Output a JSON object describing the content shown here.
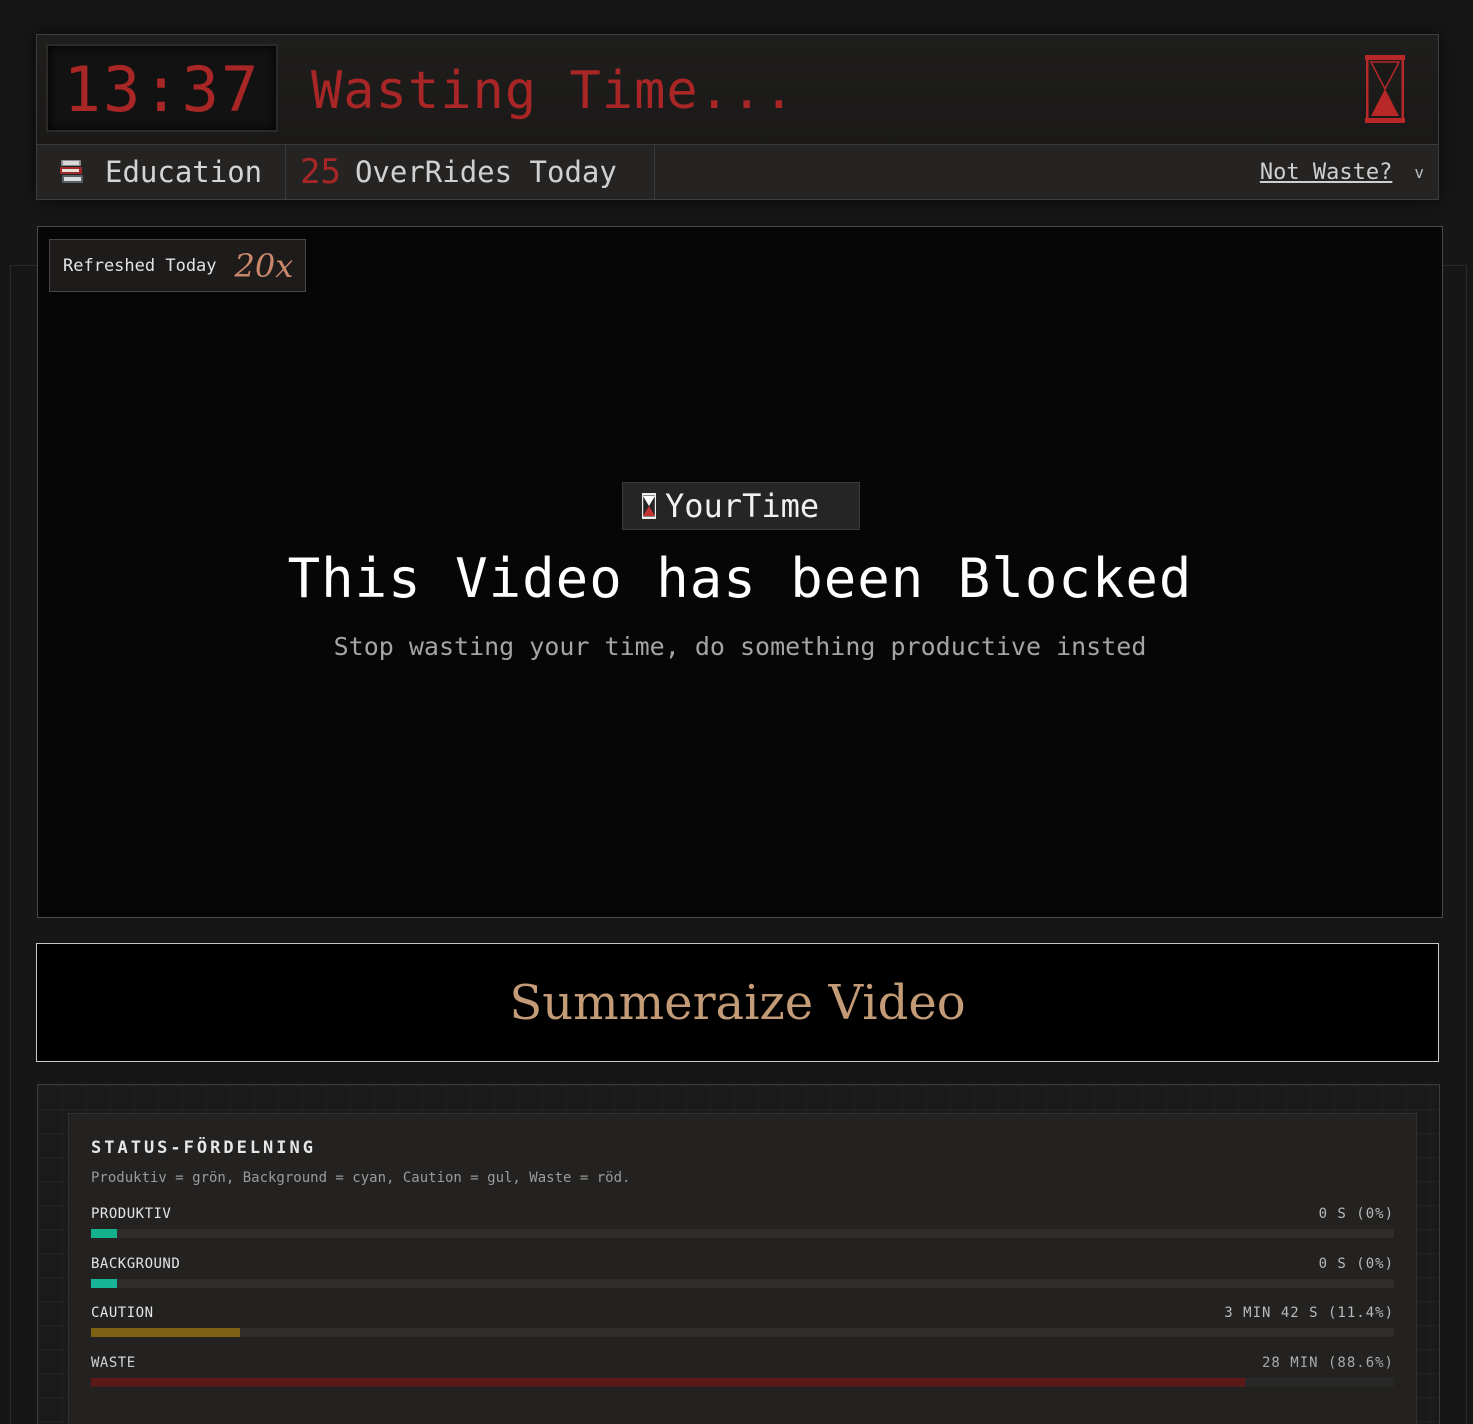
{
  "header": {
    "clock": "13:37",
    "status": "Wasting Time...",
    "category": "Education",
    "overrides_count": "25",
    "overrides_label": "OverRides Today",
    "not_waste_label": "Not Waste?",
    "chevron": "v",
    "hourglass_icon": "hourglass-icon",
    "books_icon": "books-icon",
    "accent_color": "#a82626"
  },
  "video": {
    "refreshed_label": "Refreshed Today",
    "refreshed_count": "20x",
    "brand": "YourTime",
    "title": "This Video has been Blocked",
    "subtitle": "Stop wasting your time, do something productive insted"
  },
  "summarize": {
    "label": "Summeraize Video",
    "color": "#c49b77"
  },
  "status_panel": {
    "title": "STATUS-FÖRDELNING",
    "legend": "Produktiv = grön, Background = cyan, Caution = gul, Waste = röd.",
    "rows": [
      {
        "label": "PRODUKTIV",
        "value": "0 S (0%)",
        "fraction": 0.02,
        "color": "#15b08c"
      },
      {
        "label": "BACKGROUND",
        "value": "0 S (0%)",
        "fraction": 0.02,
        "color": "#17b497"
      },
      {
        "label": "CAUTION",
        "value": "3 MIN 42 S (11.4%)",
        "fraction": 0.114,
        "color": "#7d6114"
      },
      {
        "label": "WASTE",
        "value": "28 MIN (88.6%)",
        "fraction": 0.886,
        "color": "#8a1414"
      }
    ]
  }
}
